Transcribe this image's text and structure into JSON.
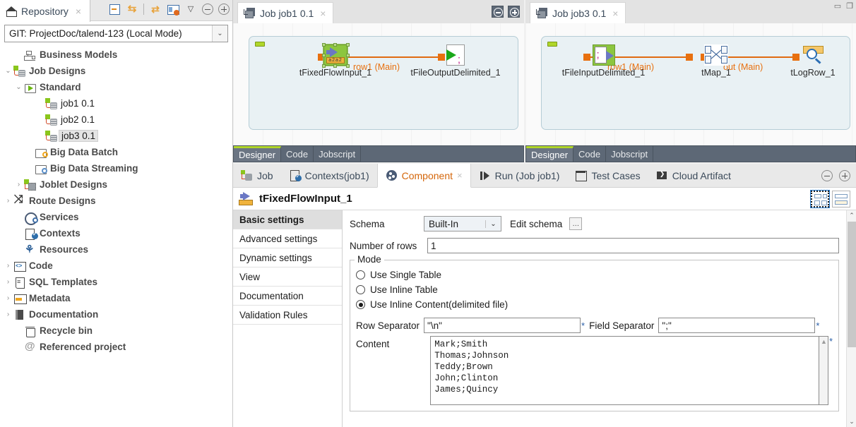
{
  "window": {
    "minimize": "▭",
    "restore": "❐"
  },
  "repository": {
    "tab_label": "Repository",
    "tab_close": "×",
    "home_icon": "home-icon",
    "toolbar": [
      {
        "name": "collapse-all-icon",
        "label": "Collapse All"
      },
      {
        "name": "link-with-editor-icon",
        "label": "Link With Editor"
      },
      {
        "name": "refresh-icon",
        "label": "Refresh"
      },
      {
        "name": "view-menu-icon",
        "label": "View Menu"
      },
      {
        "name": "minimize-icon",
        "label": "Minimize"
      },
      {
        "name": "maximize-icon",
        "label": "Maximize"
      }
    ],
    "project": {
      "value": "GIT: ProjectDoc/talend-123   (Local Mode)",
      "arrow": "⌄"
    },
    "tree": [
      {
        "label": "Business Models",
        "icon": "business-models-icon",
        "indent": 1,
        "twisty": "",
        "bold": true,
        "selected": false
      },
      {
        "label": "Job Designs",
        "icon": "job-designs-icon",
        "indent": 0,
        "twisty": "⌄",
        "bold": true,
        "selected": false
      },
      {
        "label": "Standard",
        "icon": "standard-folder-icon",
        "indent": 1,
        "twisty": "⌄",
        "bold": true,
        "selected": false
      },
      {
        "label": "job1 0.1",
        "icon": "job-icon",
        "indent": 3,
        "twisty": "",
        "bold": false,
        "selected": false
      },
      {
        "label": "job2 0.1",
        "icon": "job-icon",
        "indent": 3,
        "twisty": "",
        "bold": false,
        "selected": false
      },
      {
        "label": "job3 0.1",
        "icon": "job-icon",
        "indent": 3,
        "twisty": "",
        "bold": false,
        "selected": true
      },
      {
        "label": "Big Data Batch",
        "icon": "big-data-batch-icon",
        "indent": 2,
        "twisty": "",
        "bold": true,
        "selected": false
      },
      {
        "label": "Big Data Streaming",
        "icon": "big-data-streaming-icon",
        "indent": 2,
        "twisty": "",
        "bold": true,
        "selected": false
      },
      {
        "label": "Joblet Designs",
        "icon": "joblet-designs-icon",
        "indent": 1,
        "twisty": "›",
        "bold": true,
        "selected": false
      },
      {
        "label": "Route Designs",
        "icon": "route-designs-icon",
        "indent": 0,
        "twisty": "›",
        "bold": true,
        "selected": false
      },
      {
        "label": "Services",
        "icon": "services-icon",
        "indent": 1,
        "twisty": "",
        "bold": true,
        "selected": false
      },
      {
        "label": "Contexts",
        "icon": "contexts-icon",
        "indent": 1,
        "twisty": "",
        "bold": true,
        "selected": false
      },
      {
        "label": "Resources",
        "icon": "resources-icon",
        "indent": 1,
        "twisty": "",
        "bold": true,
        "selected": false
      },
      {
        "label": "Code",
        "icon": "code-icon",
        "indent": 0,
        "twisty": "›",
        "bold": true,
        "selected": false
      },
      {
        "label": "SQL Templates",
        "icon": "sql-templates-icon",
        "indent": 0,
        "twisty": "›",
        "bold": true,
        "selected": false
      },
      {
        "label": "Metadata",
        "icon": "metadata-icon",
        "indent": 0,
        "twisty": "›",
        "bold": true,
        "selected": false
      },
      {
        "label": "Documentation",
        "icon": "documentation-icon",
        "indent": 0,
        "twisty": "›",
        "bold": true,
        "selected": false
      },
      {
        "label": "Recycle bin",
        "icon": "recycle-bin-icon",
        "indent": 1,
        "twisty": "",
        "bold": true,
        "selected": false
      },
      {
        "label": "Referenced project",
        "icon": "referenced-project-icon",
        "indent": 1,
        "twisty": "",
        "bold": true,
        "selected": false
      }
    ]
  },
  "editors": [
    {
      "id": "job1",
      "tab_label": "Job job1 0.1",
      "tab_close": "×",
      "bottom_tabs": [
        {
          "label": "Designer",
          "active": true
        },
        {
          "label": "Code",
          "active": false
        },
        {
          "label": "Jobscript",
          "active": false
        }
      ],
      "nodes": [
        {
          "name": "tFixedFlowInput_1",
          "selected": true
        },
        {
          "name": "tFileOutputDelimited_1",
          "selected": false
        }
      ],
      "links": [
        {
          "label": "row1 (Main)"
        }
      ]
    },
    {
      "id": "job3",
      "tab_label": "Job job3 0.1",
      "tab_close": "×",
      "bottom_tabs": [
        {
          "label": "Designer",
          "active": true
        },
        {
          "label": "Code",
          "active": false
        },
        {
          "label": "Jobscript",
          "active": false
        }
      ],
      "nodes": [
        {
          "name": "tFileInputDelimited_1",
          "selected": false
        },
        {
          "name": "tMap_1",
          "selected": false
        },
        {
          "name": "tLogRow_1",
          "selected": false
        }
      ],
      "links": [
        {
          "label": "row1 (Main)"
        },
        {
          "label": "out (Main)"
        }
      ]
    }
  ],
  "properties": {
    "tabs": [
      {
        "label": "Job",
        "icon": "job-icon",
        "active": false
      },
      {
        "label": "Contexts(job1)",
        "icon": "contexts-icon",
        "active": false
      },
      {
        "label": "Component",
        "icon": "component-icon",
        "active": true,
        "close": "×"
      },
      {
        "label": "Run (Job job1)",
        "icon": "run-icon",
        "active": false
      },
      {
        "label": "Test Cases",
        "icon": "test-cases-icon",
        "active": false
      },
      {
        "label": "Cloud Artifact",
        "icon": "cloud-artifact-icon",
        "active": false
      }
    ],
    "component_title": "tFixedFlowInput_1",
    "layout_buttons": [
      {
        "name": "grid-layout-button",
        "selected": true
      },
      {
        "name": "list-layout-button",
        "selected": false
      }
    ],
    "settings_list": [
      {
        "label": "Basic settings",
        "active": true
      },
      {
        "label": "Advanced settings",
        "active": false
      },
      {
        "label": "Dynamic settings",
        "active": false
      },
      {
        "label": "View",
        "active": false
      },
      {
        "label": "Documentation",
        "active": false
      },
      {
        "label": "Validation Rules",
        "active": false
      }
    ],
    "form": {
      "schema_label": "Schema",
      "schema_value": "Built-In",
      "schema_arrow": "⌄",
      "edit_schema_label": "Edit schema",
      "edit_schema_dots": "…",
      "number_of_rows_label": "Number of rows",
      "number_of_rows_value": "1",
      "mode_group_title": "Mode",
      "mode_options": [
        {
          "label": "Use Single Table",
          "selected": false
        },
        {
          "label": "Use Inline Table",
          "selected": false
        },
        {
          "label": "Use Inline Content(delimited file)",
          "selected": true
        }
      ],
      "row_separator_label": "Row Separator",
      "row_separator_value": "\"\\n\"",
      "field_separator_label": "Field Separator",
      "field_separator_value": "\";\"",
      "required_mark": "*",
      "content_label": "Content",
      "content_value": "Mark;Smith\nThomas;Johnson\nTeddy;Brown\nJohn;Clinton\nJames;Quincy"
    },
    "scroll": {
      "up": "⌃",
      "down": "⌄"
    }
  },
  "colors": {
    "accent_orange": "#e8700f",
    "active_tab_text": "#d4660a",
    "green_highlight": "#8cc63f",
    "dark_bar": "#5d6876"
  }
}
